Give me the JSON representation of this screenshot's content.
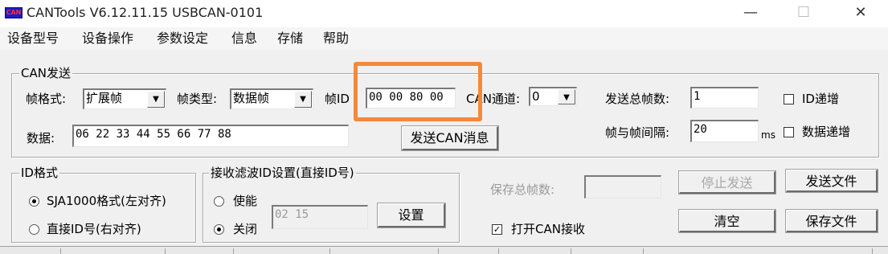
{
  "window": {
    "app_icon_text": "CAN",
    "title": "CANTools V6.12.11.15  USBCAN-0101",
    "minimize_glyph": "—",
    "maximize_glyph": "☐",
    "close_glyph": "✕"
  },
  "menu": [
    "设备型号",
    "设备操作",
    "参数设定",
    "信息",
    "存储",
    "帮助"
  ],
  "can_send": {
    "legend": "CAN发送",
    "frame_format_label": "帧格式:",
    "frame_format_value": "扩展帧",
    "frame_type_label": "帧类型:",
    "frame_type_value": "数据帧",
    "frame_id_label": "帧ID",
    "frame_id_value": "00 00 80 00",
    "channel_label": "CAN通道:",
    "channel_value": "0",
    "total_frames_label": "发送总帧数:",
    "total_frames_value": "1",
    "id_increment_label": "ID递增",
    "data_label": "数据:",
    "data_value": "06 22 33 44 55 66 77 88",
    "send_button": "发送CAN消息",
    "interval_label": "帧与帧间隔:",
    "interval_value": "20",
    "interval_unit": "ms",
    "data_increment_label": "数据递增"
  },
  "id_format": {
    "legend": "ID格式",
    "option_sja": "SJA1000格式(左对齐)",
    "option_direct": "直接ID号(右对齐)",
    "selected": "sja1000"
  },
  "rx_filter": {
    "legend": "接收滤波ID设置(直接ID号)",
    "enable_label": "使能",
    "disable_label": "关闭",
    "selected": "disable",
    "filter_value": "02 15",
    "set_button": "设置"
  },
  "actions": {
    "save_total_label": "保存总帧数:",
    "stop_send": "停止发送",
    "send_file": "发送文件",
    "open_receive_label": "打开CAN接收",
    "clear": "清空",
    "save_file": "保存文件"
  },
  "colors": {
    "highlight": "#f5893a",
    "window_bg": "#f0f0f0",
    "app_icon": "#1c1cc8"
  }
}
